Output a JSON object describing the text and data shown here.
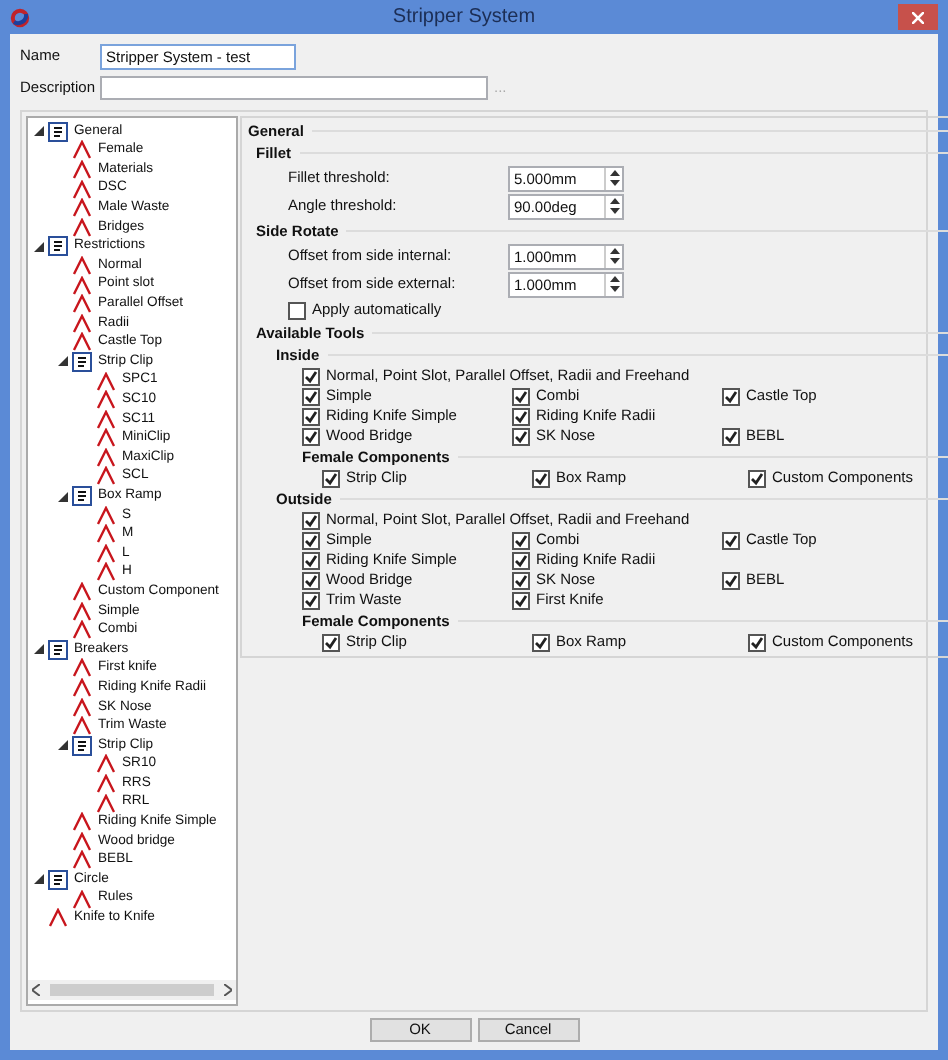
{
  "window": {
    "title": "Stripper System"
  },
  "name_field": {
    "label": "Name",
    "value": "Stripper System - test"
  },
  "description_field": {
    "label": "Description",
    "button": "..."
  },
  "tree": [
    {
      "label": "General",
      "expanded": true,
      "children": [
        {
          "label": "Female"
        },
        {
          "label": "Materials"
        },
        {
          "label": "DSC"
        },
        {
          "label": "Male Waste"
        },
        {
          "label": "Bridges"
        }
      ]
    },
    {
      "label": "Restrictions",
      "expanded": true,
      "children": [
        {
          "label": "Normal"
        },
        {
          "label": "Point slot"
        },
        {
          "label": "Parallel Offset"
        },
        {
          "label": "Radii"
        },
        {
          "label": "Castle Top"
        },
        {
          "label": "Strip Clip",
          "expanded": true,
          "children": [
            {
              "label": "SPC1"
            },
            {
              "label": "SC10"
            },
            {
              "label": "SC11"
            },
            {
              "label": "MiniClip"
            },
            {
              "label": "MaxiClip"
            },
            {
              "label": "SCL"
            }
          ]
        },
        {
          "label": "Box Ramp",
          "expanded": true,
          "children": [
            {
              "label": "S"
            },
            {
              "label": "M"
            },
            {
              "label": "L"
            },
            {
              "label": "H"
            }
          ]
        },
        {
          "label": "Custom Component"
        },
        {
          "label": "Simple"
        },
        {
          "label": "Combi"
        }
      ]
    },
    {
      "label": "Breakers",
      "expanded": true,
      "children": [
        {
          "label": "First knife"
        },
        {
          "label": "Riding Knife Radii"
        },
        {
          "label": "SK Nose"
        },
        {
          "label": "Trim Waste"
        },
        {
          "label": "Strip Clip",
          "expanded": true,
          "children": [
            {
              "label": "SR10"
            },
            {
              "label": "RRS"
            },
            {
              "label": "RRL"
            }
          ]
        },
        {
          "label": "Riding Knife Simple"
        },
        {
          "label": "Wood bridge"
        },
        {
          "label": "BEBL"
        }
      ]
    },
    {
      "label": "Circle",
      "expanded": true,
      "children": [
        {
          "label": "Rules"
        }
      ]
    },
    {
      "label": "Knife to Knife"
    }
  ],
  "panel": {
    "title": "General",
    "fillet": {
      "title": "Fillet",
      "fields": [
        {
          "label": "Fillet threshold:",
          "value": "5.000mm"
        },
        {
          "label": "Angle threshold:",
          "value": "90.00deg"
        }
      ]
    },
    "side_rotate": {
      "title": "Side Rotate",
      "fields": [
        {
          "label": "Offset from side internal:",
          "value": "1.000mm"
        },
        {
          "label": "Offset from side external:",
          "value": "1.000mm"
        }
      ],
      "apply": {
        "label": "Apply automatically",
        "checked": false
      }
    },
    "available_tools": {
      "title": "Available Tools",
      "groups": [
        {
          "title": "Inside",
          "full": {
            "label": "Normal, Point Slot, Parallel Offset, Radii and Freehand",
            "checked": true
          },
          "rows": [
            [
              {
                "label": "Simple",
                "checked": true
              },
              {
                "label": "Combi",
                "checked": true
              },
              {
                "label": "Castle Top",
                "checked": true
              }
            ],
            [
              {
                "label": "Riding Knife Simple",
                "checked": true
              },
              {
                "label": "Riding Knife Radii",
                "checked": true
              }
            ],
            [
              {
                "label": "Wood Bridge",
                "checked": true
              },
              {
                "label": "SK Nose",
                "checked": true
              },
              {
                "label": "BEBL",
                "checked": true
              }
            ]
          ],
          "female": {
            "title": "Female Components",
            "items": [
              {
                "label": "Strip Clip",
                "checked": true
              },
              {
                "label": "Box Ramp",
                "checked": true
              },
              {
                "label": "Custom Components",
                "checked": true
              }
            ]
          }
        },
        {
          "title": "Outside",
          "full": {
            "label": "Normal, Point Slot, Parallel Offset, Radii and Freehand",
            "checked": true
          },
          "rows": [
            [
              {
                "label": "Simple",
                "checked": true
              },
              {
                "label": "Combi",
                "checked": true
              },
              {
                "label": "Castle Top",
                "checked": true
              }
            ],
            [
              {
                "label": "Riding Knife Simple",
                "checked": true
              },
              {
                "label": "Riding Knife Radii",
                "checked": true
              }
            ],
            [
              {
                "label": "Wood Bridge",
                "checked": true
              },
              {
                "label": "SK Nose",
                "checked": true
              },
              {
                "label": "BEBL",
                "checked": true
              }
            ],
            [
              {
                "label": "Trim Waste",
                "checked": true
              },
              {
                "label": "First Knife",
                "checked": true
              }
            ]
          ],
          "female": {
            "title": "Female Components",
            "items": [
              {
                "label": "Strip Clip",
                "checked": true
              },
              {
                "label": "Box Ramp",
                "checked": true
              },
              {
                "label": "Custom Components",
                "checked": true
              }
            ]
          }
        }
      ]
    }
  },
  "buttons": [
    "OK",
    "Cancel"
  ]
}
